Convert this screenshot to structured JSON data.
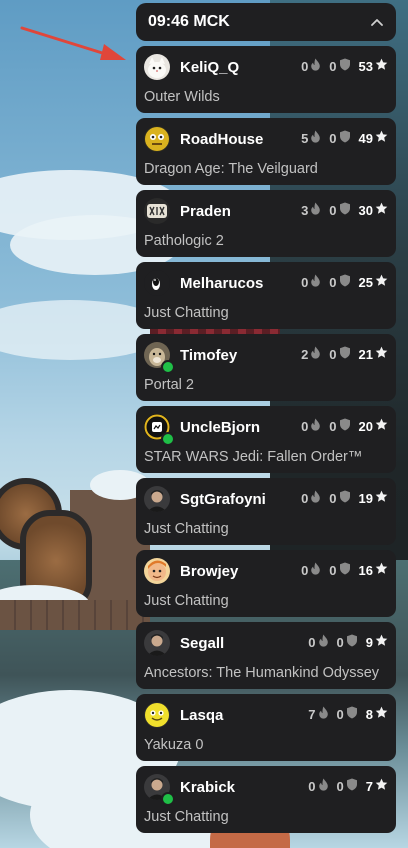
{
  "header": {
    "time": "09:46 MCK",
    "collapse_icon": "chevron-up-icon"
  },
  "icons": {
    "fire": "fire-icon",
    "shield": "shield-icon",
    "star": "star-icon"
  },
  "colors": {
    "card_bg": "#1f1f21",
    "live": "#1fbf47",
    "arrow": "#e0463a"
  },
  "streamers": [
    {
      "name": "KeliQ_Q",
      "game": "Outer Wilds",
      "fire": "0",
      "shield": "0",
      "stars": "53",
      "live": false,
      "avatar": "cat-avatar"
    },
    {
      "name": "RoadHouse",
      "game": "Dragon Age: The Veilguard",
      "fire": "5",
      "shield": "0",
      "stars": "49",
      "live": false,
      "avatar": "yellow-face-avatar"
    },
    {
      "name": "Praden",
      "game": "Pathologic 2",
      "fire": "3",
      "shield": "0",
      "stars": "30",
      "live": false,
      "avatar": "rune-avatar"
    },
    {
      "name": "Melharucos",
      "game": "Just Chatting",
      "fire": "0",
      "shield": "0",
      "stars": "25",
      "live": false,
      "avatar": "penguin-avatar"
    },
    {
      "name": "Timofey",
      "game": "Portal 2",
      "fire": "2",
      "shield": "0",
      "stars": "21",
      "live": true,
      "avatar": "dog-avatar"
    },
    {
      "name": "UncleBjorn",
      "game": "STAR WARS Jedi: Fallen Order™",
      "fire": "0",
      "shield": "0",
      "stars": "20",
      "live": true,
      "avatar": "logo-avatar"
    },
    {
      "name": "SgtGrafoyni",
      "game": "Just Chatting",
      "fire": "0",
      "shield": "0",
      "stars": "19",
      "live": false,
      "avatar": "person-avatar"
    },
    {
      "name": "Browjey",
      "game": "Just Chatting",
      "fire": "0",
      "shield": "0",
      "stars": "16",
      "live": false,
      "avatar": "cartoon-avatar"
    },
    {
      "name": "Segall",
      "game": "Ancestors: The Humankind Odyssey",
      "fire": "0",
      "shield": "0",
      "stars": "9",
      "live": false,
      "avatar": "person-avatar"
    },
    {
      "name": "Lasqa",
      "game": "Yakuza 0",
      "fire": "7",
      "shield": "0",
      "stars": "8",
      "live": false,
      "avatar": "smiley-avatar"
    },
    {
      "name": "Krabick",
      "game": "Just Chatting",
      "fire": "0",
      "shield": "0",
      "stars": "7",
      "live": true,
      "avatar": "person-avatar"
    }
  ]
}
